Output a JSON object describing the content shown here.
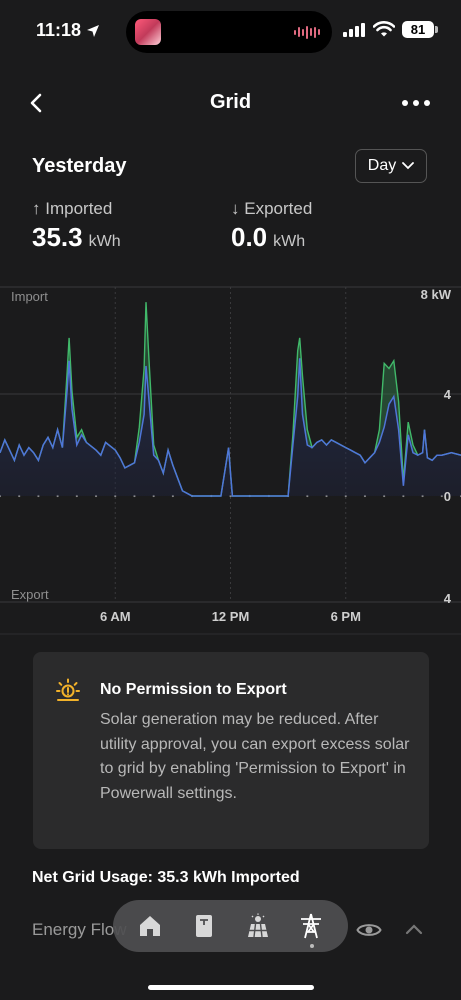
{
  "status_bar": {
    "time": "11:18",
    "battery": "81"
  },
  "header": {
    "title": "Grid"
  },
  "summary": {
    "period": "Yesterday",
    "range_selector": "Day",
    "imported": {
      "arrow": "↑",
      "label": "Imported",
      "value": "35.3",
      "unit": "kWh"
    },
    "exported": {
      "arrow": "↓",
      "label": "Exported",
      "value": "0.0",
      "unit": "kWh"
    }
  },
  "chart_data": {
    "type": "area",
    "top_label": "Import",
    "bottom_label": "Export",
    "y_unit": "kW",
    "y_ticks_right": [
      "8 kW",
      "4",
      "0",
      "4"
    ],
    "x_ticks": [
      "6 AM",
      "12 PM",
      "6 PM"
    ],
    "ylim": [
      -4,
      8
    ],
    "x_hours": [
      0,
      0.25,
      0.5,
      0.75,
      1,
      1.25,
      1.5,
      1.75,
      2,
      2.25,
      2.5,
      2.75,
      3,
      3.25,
      3.5,
      3.6,
      3.75,
      4,
      4.25,
      4.5,
      5,
      5.25,
      5.5,
      6,
      6.25,
      6.5,
      7,
      7.25,
      7.5,
      7.6,
      7.75,
      8,
      8.25,
      8.5,
      8.75,
      9,
      9.25,
      9.5,
      9.75,
      10,
      10.25,
      10.5,
      10.75,
      11,
      11.5,
      11.9,
      12,
      12.1,
      12.5,
      13,
      13.5,
      14,
      14.5,
      15,
      15.25,
      15.5,
      15.6,
      15.75,
      16,
      16.25,
      16.5,
      16.75,
      17,
      17.25,
      17.5,
      18,
      18.25,
      18.5,
      18.75,
      19,
      19.5,
      19.75,
      20,
      20.25,
      20.5,
      20.75,
      21,
      21.25,
      21.5,
      21.75,
      22,
      22.1,
      22.25,
      22.5,
      22.75,
      23,
      23.5,
      24
    ],
    "series": [
      {
        "name": "Grid",
        "color": "#4f75d9",
        "values": [
          1.7,
          2.2,
          1.8,
          1.4,
          2.0,
          1.6,
          1.9,
          1.7,
          1.4,
          2.0,
          2.3,
          1.9,
          2.6,
          1.9,
          4.2,
          5.3,
          3.4,
          2.0,
          2.4,
          2.1,
          1.8,
          1.6,
          2.1,
          1.8,
          1.5,
          1.1,
          1.3,
          2.1,
          3.2,
          5.1,
          3.8,
          1.6,
          1.4,
          0.9,
          1.8,
          1.2,
          0.7,
          0.2,
          0.1,
          0,
          0,
          0,
          0,
          0,
          0,
          1.9,
          0.9,
          0,
          0,
          0,
          0,
          0,
          0,
          0,
          2.0,
          3.9,
          5.4,
          3.2,
          2.0,
          1.9,
          2.1,
          2.2,
          2.0,
          2.2,
          2.1,
          1.9,
          1.8,
          1.7,
          1.6,
          1.3,
          1.7,
          2.1,
          2.7,
          3.6,
          3.9,
          2.6,
          0.4,
          2.4,
          1.7,
          1.6,
          1.7,
          2.6,
          1.5,
          1.4,
          1.6,
          1.6,
          1.7,
          1.6
        ]
      },
      {
        "name": "",
        "color": "#41b96a",
        "values": [
          0,
          0,
          0,
          0,
          0,
          0,
          0,
          0,
          0,
          0,
          0,
          0,
          0,
          0,
          0.7,
          0.9,
          0.7,
          0.3,
          0.2,
          0,
          0,
          0,
          0,
          0,
          0,
          0,
          0,
          0.6,
          1.8,
          2.5,
          1.6,
          0.4,
          0,
          0,
          0,
          0,
          0,
          0,
          0,
          0,
          0,
          0,
          0,
          0,
          0,
          0,
          0,
          0,
          0,
          0,
          0,
          0,
          0,
          0,
          0.4,
          1.8,
          0.8,
          1.5,
          0.6,
          0,
          0,
          0,
          0,
          0,
          0,
          0,
          0,
          0,
          0,
          0,
          0,
          0.5,
          2.5,
          1.4,
          1.4,
          1.1,
          0.2,
          0.5,
          0.3,
          0,
          0,
          0,
          0,
          0,
          0,
          0,
          0,
          0
        ]
      }
    ]
  },
  "notice": {
    "title": "No Permission to Export",
    "body": "Solar generation may be reduced. After utility approval, you can export excess solar to grid by enabling 'Permission to Export' in Powerwall settings.",
    "icon": "sun-warning-icon"
  },
  "net_usage": "Net Grid Usage: 35.3 kWh Imported",
  "energy_flow": "Energy Flow",
  "dock": {
    "active": "grid-tower"
  }
}
